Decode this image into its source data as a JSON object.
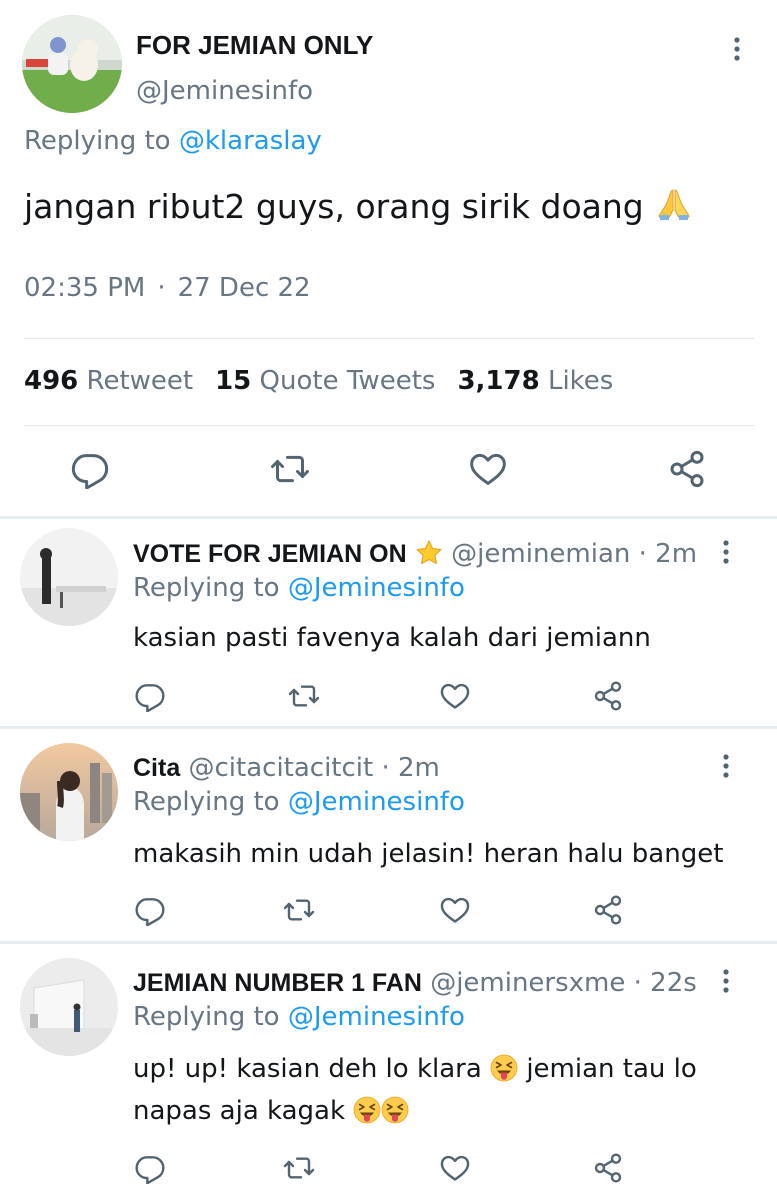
{
  "main_tweet": {
    "display_name": "FOR JEMIAN ONLY",
    "handle": "@Jeminesinfo",
    "replying_prefix": "Replying to",
    "replying_to": "@klaraslay",
    "text": "jangan ribut2 guys, orang sirik doang",
    "text_emoji": "folded-hands",
    "time": "02:35 PM",
    "separator": "·",
    "date": "27 Dec 22",
    "stats": {
      "retweet_count": "496",
      "retweet_label": "Retweet",
      "quote_count": "15",
      "quote_label": "Quote Tweets",
      "likes_count": "3,178",
      "likes_label": "Likes"
    }
  },
  "replies": [
    {
      "display_name": "VOTE FOR JEMIAN ON",
      "name_emoji": "star",
      "handle": "@jeminemian",
      "age": "· 2m",
      "replying_prefix": "Replying to",
      "replying_to": "@Jeminesinfo",
      "text": "kasian pasti favenya kalah dari jemiann"
    },
    {
      "display_name": "Cita",
      "handle": "@citacitacitcit",
      "age": "· 2m",
      "replying_prefix": "Replying to",
      "replying_to": "@Jeminesinfo",
      "text": "makasih min udah jelasin! heran halu banget"
    },
    {
      "display_name": "JEMIAN NUMBER 1 FAN",
      "handle": "@jeminersxme",
      "age": "· 22s",
      "replying_prefix": "Replying to",
      "replying_to": "@Jeminesinfo",
      "text_part1": "up! up! kasian deh lo klara",
      "text_part2": "jemian tau lo",
      "text_part3": "napas aja kagak",
      "text_emoji": "squinting-tongue-face"
    }
  ],
  "colors": {
    "link_blue": "#1d9bf0",
    "secondary_gray": "#687684",
    "icon_gray": "#536471",
    "divider": "#e1e8ed"
  },
  "icons": [
    "more-vertical-icon",
    "reply-icon",
    "retweet-icon",
    "like-icon",
    "share-icon"
  ]
}
